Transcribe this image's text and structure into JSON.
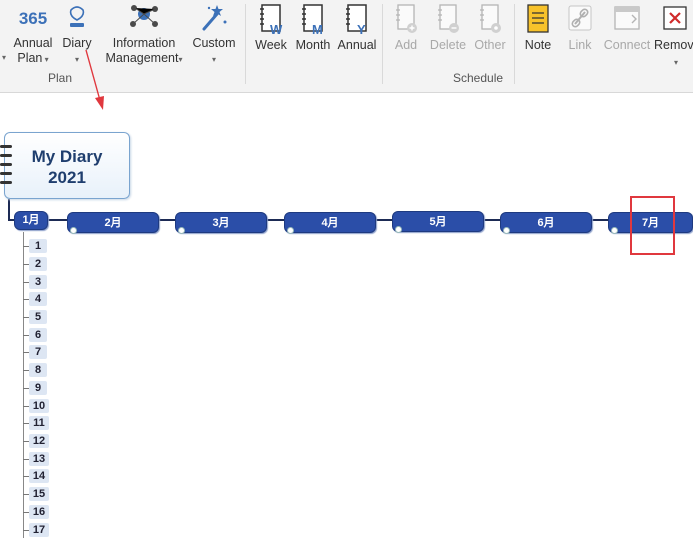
{
  "ribbon": {
    "buttons": {
      "annual_plan": {
        "icon_text": "365",
        "line1": "Annual",
        "line2": "Plan"
      },
      "diary": {
        "label": "Diary"
      },
      "information_management": {
        "line1": "Information",
        "line2": "Management"
      },
      "custom": {
        "label": "Custom"
      },
      "week": {
        "label": "Week"
      },
      "month": {
        "label": "Month"
      },
      "annual": {
        "label": "Annual"
      },
      "add": {
        "label": "Add"
      },
      "delete": {
        "label": "Delete"
      },
      "other": {
        "label": "Other"
      },
      "note": {
        "label": "Note"
      },
      "link": {
        "label": "Link"
      },
      "connect": {
        "label": "Connect"
      },
      "remove": {
        "label": "Remov"
      }
    },
    "groups": {
      "plan": "Plan",
      "schedule": "Schedule"
    },
    "icon_letters": {
      "week": "W",
      "month": "M",
      "annual": "Y"
    }
  },
  "canvas": {
    "root_topic": {
      "line1": "My Diary",
      "line2": "2021"
    },
    "months": [
      "1月",
      "2月",
      "3月",
      "4月",
      "5月",
      "6月",
      "7月"
    ],
    "days": [
      "1",
      "2",
      "3",
      "4",
      "5",
      "6",
      "7",
      "8",
      "9",
      "10",
      "11",
      "12",
      "13",
      "14",
      "15",
      "16",
      "17"
    ]
  },
  "colors": {
    "month_fill": "#2b4ea8",
    "day_fill": "#dde6f3",
    "highlight": "#e0383e",
    "arrow": "#e0383e"
  }
}
